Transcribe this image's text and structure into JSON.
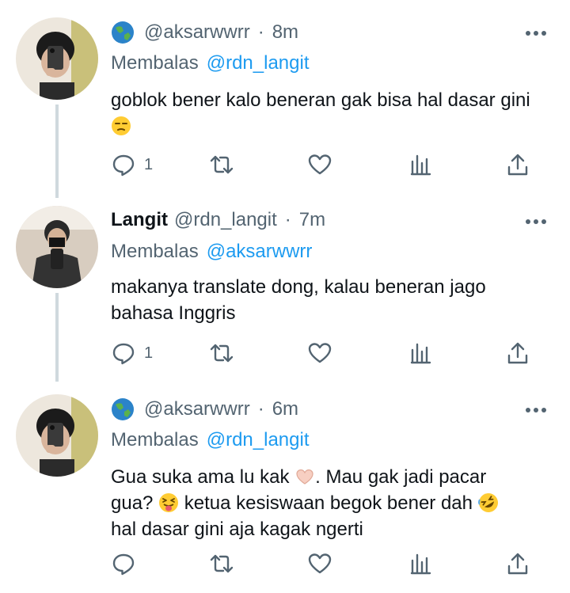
{
  "tweets": [
    {
      "display_name": "",
      "has_globe_emoji": true,
      "handle": "@aksarwwrr",
      "separator": "·",
      "time": "8m",
      "reply_prefix": "Membalas",
      "reply_to": "@rdn_langit",
      "text_lines": [
        "goblok bener kalo beneran gak bisa hal dasar gini"
      ],
      "emoji_after": "unamused-face",
      "reply_count": "1",
      "retweet_count": "",
      "like_count": ""
    },
    {
      "display_name": "Langit",
      "has_globe_emoji": false,
      "handle": "@rdn_langit",
      "separator": "·",
      "time": "7m",
      "reply_prefix": "Membalas",
      "reply_to": "@aksarwwrr",
      "text_lines": [
        "makanya translate dong, kalau beneran jago",
        "bahasa Inggris"
      ],
      "reply_count": "1",
      "retweet_count": "",
      "like_count": ""
    },
    {
      "display_name": "",
      "has_globe_emoji": true,
      "handle": "@aksarwwrr",
      "separator": "·",
      "time": "6m",
      "reply_prefix": "Membalas",
      "reply_to": "@rdn_langit",
      "text": {
        "l1a": "Gua suka ama lu kak",
        "l1b": ". Mau gak jadi pacar",
        "l2a": "gua?",
        "l2b": "ketua kesiswaan begok bener dah",
        "l3": "hal dasar gini aja kagak ngerti"
      },
      "emojis": [
        "heart-hands",
        "squinting-tongue-face",
        "rofl-face"
      ],
      "reply_count": "",
      "retweet_count": "",
      "like_count": ""
    }
  ],
  "colors": {
    "text": "#0f1419",
    "muted": "#536471",
    "link": "#1d9bf0",
    "thread_line": "#cfd9de"
  }
}
